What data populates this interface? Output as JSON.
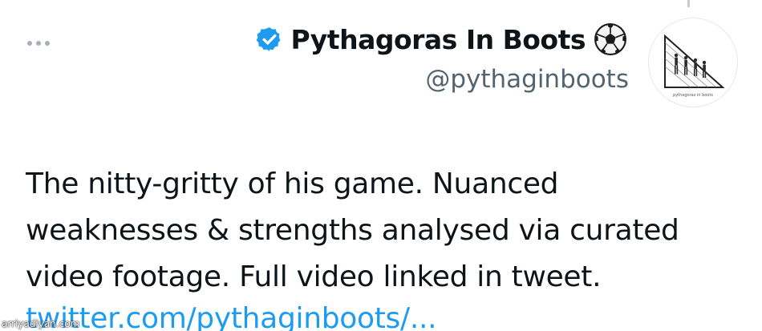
{
  "tweet": {
    "author": {
      "display_name": "Pythagoras In Boots",
      "handle": "@pythaginboots",
      "verified_icon": "verified-badge-icon",
      "emoji_icon": "soccer-ball-icon",
      "avatar_caption": "pythagoras in boots"
    },
    "more_icon": "more-options-icon",
    "text_lines": [
      "The nitty-gritty of his game. Nuanced",
      "weaknesses & strengths analysed via curated",
      "video footage. Full video linked in tweet."
    ],
    "link_text": "twitter.com/pythaginboots/..."
  },
  "watermark": "arriyadiyah.com",
  "colors": {
    "verified": "#1d9bf0",
    "link": "#1d9bf0",
    "handle": "#536471",
    "text": "#0f1419"
  }
}
